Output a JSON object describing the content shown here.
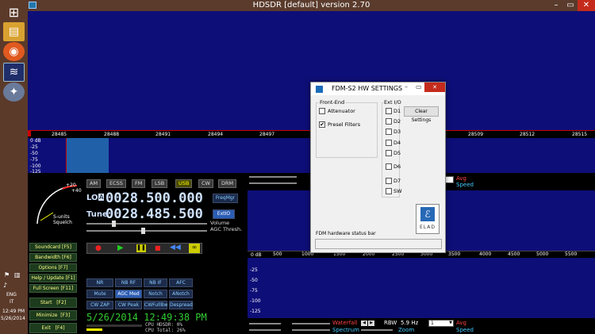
{
  "window": {
    "title": "HDSDR [default]  version 2.70",
    "min": "–",
    "max": "▭",
    "close": "✕"
  },
  "taskbar": {
    "time": "12:49 PM",
    "date": "5/26/2014",
    "lang": "ENG",
    "lang2": "IT"
  },
  "ruler": {
    "ticks": [
      "28485",
      "28488",
      "28491",
      "28494",
      "28497",
      "28509",
      "28512",
      "28515"
    ]
  },
  "spectrum_top": {
    "db_labels": [
      "0 dB",
      "-25",
      "-50",
      "-75",
      "-100",
      "-125"
    ]
  },
  "modes": [
    "AM",
    "ECSS",
    "FM",
    "LSB",
    "USB",
    "CW",
    "DRM"
  ],
  "active_mode": "USB",
  "lo": {
    "label": "LO",
    "letter": "A",
    "value": "0028.500.000",
    "btn": "FreqMgr"
  },
  "tune": {
    "label": "Tune",
    "value": "0028.485.500",
    "btn": "ExtIO"
  },
  "volume_label": "Volume",
  "agc_label": "AGC Thresh.",
  "smeter": {
    "label1": "S-units",
    "label2": "Squelch",
    "p20": "+20",
    "p40": "+40"
  },
  "side_buttons": [
    "Soundcard [F5]",
    "Bandwidth [F6]",
    "Options [F7]",
    "Help / Update [F1]",
    "Full Screen [F11]"
  ],
  "start_btn": {
    "label": "Start",
    "key": "[F2]"
  },
  "min_btn": {
    "label": "Minimize",
    "key": "[F3]"
  },
  "exit_btn": {
    "label": "Exit",
    "key": "[F4]"
  },
  "dsp_row1": [
    "NR",
    "NB RF",
    "NB IF",
    "AFC"
  ],
  "dsp_row2": [
    "Mute",
    "AGC Med",
    "Notch",
    "ANotch"
  ],
  "dsp_row3": [
    "CW ZAP",
    "CW Peak",
    "CWFullBw",
    "Despread"
  ],
  "clock": "5/26/2014 12:49:38 PM",
  "cpu1": "CPU HDSDR:  0%",
  "cpu2": "CPU Total: 26%",
  "right_top": {
    "avg": "Avg",
    "speed": "Speed"
  },
  "audio_axis": [
    "0 dB",
    "500",
    "1000",
    "1500",
    "2000",
    "2500",
    "3000",
    "3500",
    "4000",
    "4500",
    "5000",
    "5500"
  ],
  "audio_db": [
    "-25",
    "-50",
    "-75",
    "-100",
    "-125"
  ],
  "bottom_bar": {
    "waterfall": "Waterfall",
    "spectrum": "Spectrum",
    "rbw": "RBW",
    "rbw_val": "5.9 Hz",
    "sel": "1",
    "zoom": "Zoom",
    "avg": "Avg",
    "speed": "Speed"
  },
  "dialog": {
    "title": "FDM-S2 HW SETTINGS",
    "frontend": "Front-End",
    "attenuator": "Attenuator",
    "presel": "Presel Filters",
    "extio": "Ext I/O",
    "d": [
      "D1",
      "D2",
      "D3",
      "D4",
      "D5",
      "D6",
      "D7"
    ],
    "sw": "SW",
    "clear": "Clear Settings",
    "status": "FDM hardware status bar",
    "logo": "ELAD"
  }
}
